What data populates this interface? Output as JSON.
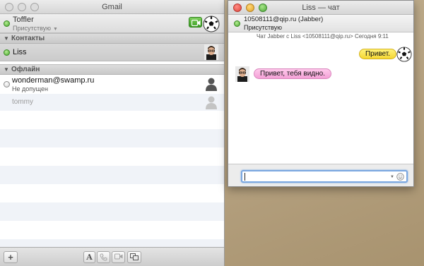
{
  "buddy_list": {
    "window_title": "Gmail",
    "account": {
      "name": "Toffler",
      "status": "Присутствую"
    },
    "groups": [
      {
        "name": "Контакты",
        "buddies": [
          {
            "name": "Liss",
            "status": "online"
          }
        ]
      },
      {
        "name": "Офлайн",
        "buddies": [
          {
            "name": "wonderman@swamp.ru",
            "note": "Не допущен",
            "status": "offline"
          },
          {
            "name": "tommy",
            "status": "offline"
          }
        ]
      }
    ],
    "toolbar": {
      "add_label": "+",
      "text_label": "A"
    }
  },
  "chat": {
    "window_title": "Liss — чат",
    "contact": "10508111@qip.ru (Jabber)",
    "contact_status": "Присутствую",
    "meta": "Чат Jabber с Liss <10508111@qip.ru>  Сегодня 9:11",
    "messages": [
      {
        "direction": "outgoing",
        "text": "Привет."
      },
      {
        "direction": "incoming",
        "text": "Привет, тебя видно."
      }
    ],
    "input": {
      "value": ""
    }
  },
  "colors": {
    "online": "#47a52c",
    "outgoing_bubble": "#f5d733",
    "incoming_bubble": "#f4a0d6",
    "input_focus": "#7aa7e0"
  },
  "icons": [
    "video-call-icon",
    "soccer-ball-avatar",
    "person-avatar",
    "smiley-icon",
    "phone-icon",
    "camera-icon",
    "screen-share-icon"
  ]
}
